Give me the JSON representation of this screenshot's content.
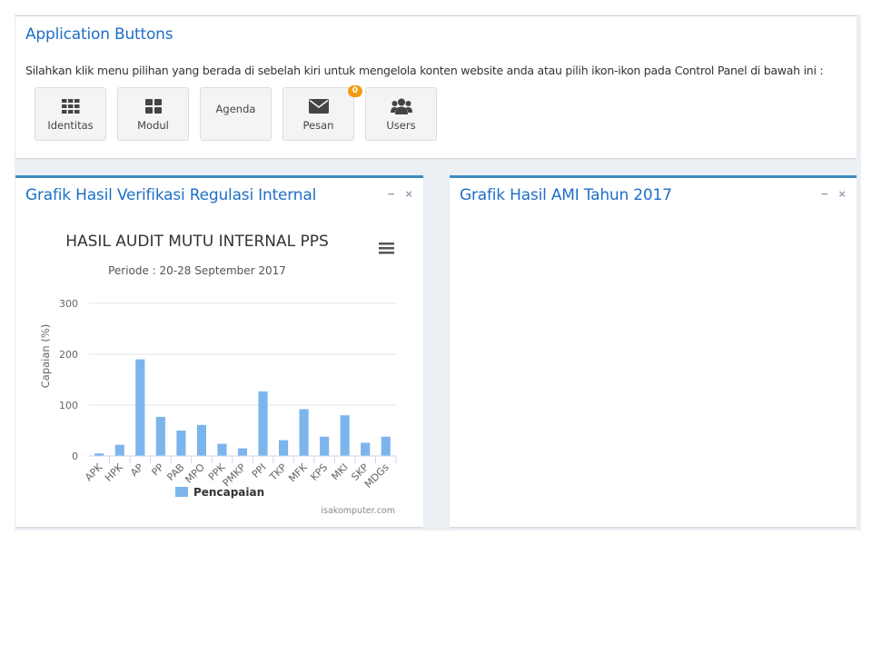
{
  "top_box": {
    "title": "Application Buttons",
    "intro": "Silahkan klik menu pilihan yang berada di sebelah kiri untuk mengelola konten website anda atau pilih ikon-ikon pada Control Panel di bawah ini :",
    "buttons": [
      {
        "label": "Identitas",
        "icon": "grid-icon"
      },
      {
        "label": "Modul",
        "icon": "th-large-icon"
      },
      {
        "label": "Agenda",
        "icon": ""
      },
      {
        "label": "Pesan",
        "icon": "envelope-icon",
        "badge": "0"
      },
      {
        "label": "Users",
        "icon": "users-icon"
      }
    ]
  },
  "left_box": {
    "title": "Grafik Hasil Verifikasi Regulasi Internal",
    "minimize": "−",
    "close": "×"
  },
  "right_box": {
    "title": "Grafik Hasil AMI Tahun 2017",
    "minimize": "−",
    "close": "×"
  },
  "chart_data": {
    "type": "bar",
    "title": "HASIL AUDIT MUTU INTERNAL PPS",
    "subtitle": "Periode : 20-28 September 2017",
    "ylabel": "Capaian (%)",
    "xlabel": "",
    "ylim": [
      0,
      300
    ],
    "yticks": [
      0,
      100,
      200,
      300
    ],
    "categories": [
      "APK",
      "HPK",
      "AP",
      "PP",
      "PAB",
      "MPO",
      "PPK",
      "PMKP",
      "PPI",
      "TKP",
      "MFK",
      "KPS",
      "MKI",
      "SKP",
      "MDGs"
    ],
    "series": [
      {
        "name": "Pencapaian",
        "values": [
          5,
          22,
          190,
          77,
          50,
          61,
          24,
          15,
          127,
          31,
          92,
          38,
          80,
          26,
          38
        ]
      }
    ],
    "legend_position": "bottom",
    "grid": true,
    "color": "#7cb5ec",
    "credits": "isakomputer.com"
  }
}
